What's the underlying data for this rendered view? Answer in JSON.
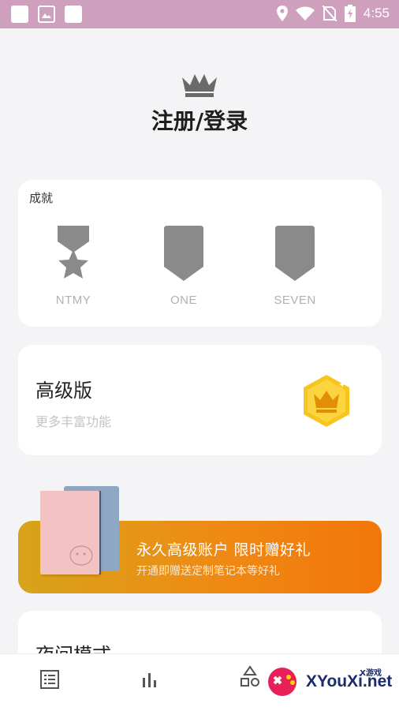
{
  "status_bar": {
    "time": "4:55",
    "icons": [
      "app-square-icon",
      "image-icon",
      "app-square-icon",
      "location-icon",
      "wifi-icon",
      "no-sim-icon",
      "battery-charging-icon"
    ]
  },
  "header": {
    "icon": "crown-icon",
    "title": "注册/登录"
  },
  "achievements": {
    "label": "成就",
    "badges": [
      {
        "name": "NTMY",
        "icon": "star-medal-icon"
      },
      {
        "name": "ONE",
        "icon": "shield-icon"
      },
      {
        "name": "SEVEN",
        "icon": "shield-icon"
      }
    ]
  },
  "premium": {
    "title": "高级版",
    "subtitle": "更多丰富功能",
    "icon": "gold-crown-hexagon-icon",
    "accent": "#f7c51e"
  },
  "promo": {
    "title": "永久高级账户  限时赠好礼",
    "subtitle": "开通即赠送定制笔记本等好礼",
    "gradient_start": "#d7a31a",
    "gradient_end": "#f2760a"
  },
  "night_mode": {
    "title": "夜间模式"
  },
  "bottom_nav": [
    {
      "icon": "list-icon"
    },
    {
      "icon": "bar-chart-icon"
    },
    {
      "icon": "shapes-icon"
    }
  ],
  "watermark": {
    "text": "XYouXi.net",
    "tag": "X游戏"
  }
}
